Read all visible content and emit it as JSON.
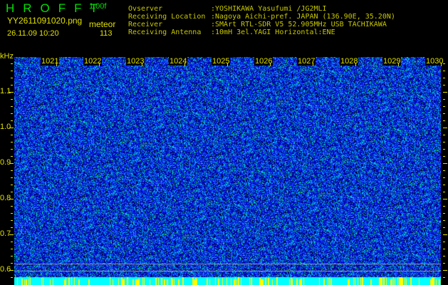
{
  "header": {
    "app_title": "HROFFT",
    "version": "1.00f",
    "filename": "YY2611091020.png",
    "datetime": "26.11.09 10:20",
    "mode": "meteor",
    "count": "113"
  },
  "info": [
    {
      "label": "Ovserver          ",
      "value": ":YOSHIKAWA Yasufumi /JG2MLI"
    },
    {
      "label": "Receiving Location ",
      "value": ":Nagoya Aichi-pref. JAPAN (136.90E, 35.20N)"
    },
    {
      "label": "Receiver          ",
      "value": ":SMArt RTL-SDR V5 52.905MHz USB TACHIKAWA"
    },
    {
      "label": "Receiving Antenna  ",
      "value": ":10mH 3el.YAGI Horizontal:ENE"
    }
  ],
  "spectrogram": {
    "y_unit": "kHz",
    "y_ticks": [
      "1.1",
      "1.0",
      "0.9",
      "0.8",
      "0.7",
      "0.6"
    ],
    "x_ticks": [
      "1021",
      "1022",
      "1023",
      "1024",
      "1025",
      "1026",
      "1027",
      "1028",
      "1029",
      "1030"
    ],
    "colors": {
      "background": "#000000",
      "noise_low": "#0000c0",
      "noise_mid": "#2040ff",
      "noise_high": "#00e0e0",
      "signal": "#00ff40",
      "strip": "#00ffff",
      "strip_marks": "#ffff00",
      "text": "#e0e000"
    }
  }
}
